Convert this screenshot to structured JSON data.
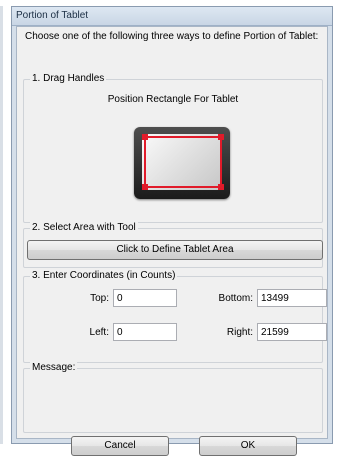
{
  "window": {
    "title": "Portion of Tablet"
  },
  "instruction": "Choose one of the following three ways to define Portion of Tablet:",
  "drag_section": {
    "label": "1. Drag Handles",
    "caption": "Position Rectangle For Tablet",
    "handle_color": "#e11b2a"
  },
  "select_section": {
    "label": "2. Select Area with Tool",
    "button_label": "Click to Define Tablet Area"
  },
  "coords_section": {
    "label": "3. Enter Coordinates (in Counts)",
    "top_label": "Top:",
    "top_value": "0",
    "bottom_label": "Bottom:",
    "bottom_value": "13499",
    "left_label": "Left:",
    "left_value": "0",
    "right_label": "Right:",
    "right_value": "21599"
  },
  "message_section": {
    "label": "Message:"
  },
  "buttons": {
    "cancel": "Cancel",
    "ok": "OK"
  }
}
